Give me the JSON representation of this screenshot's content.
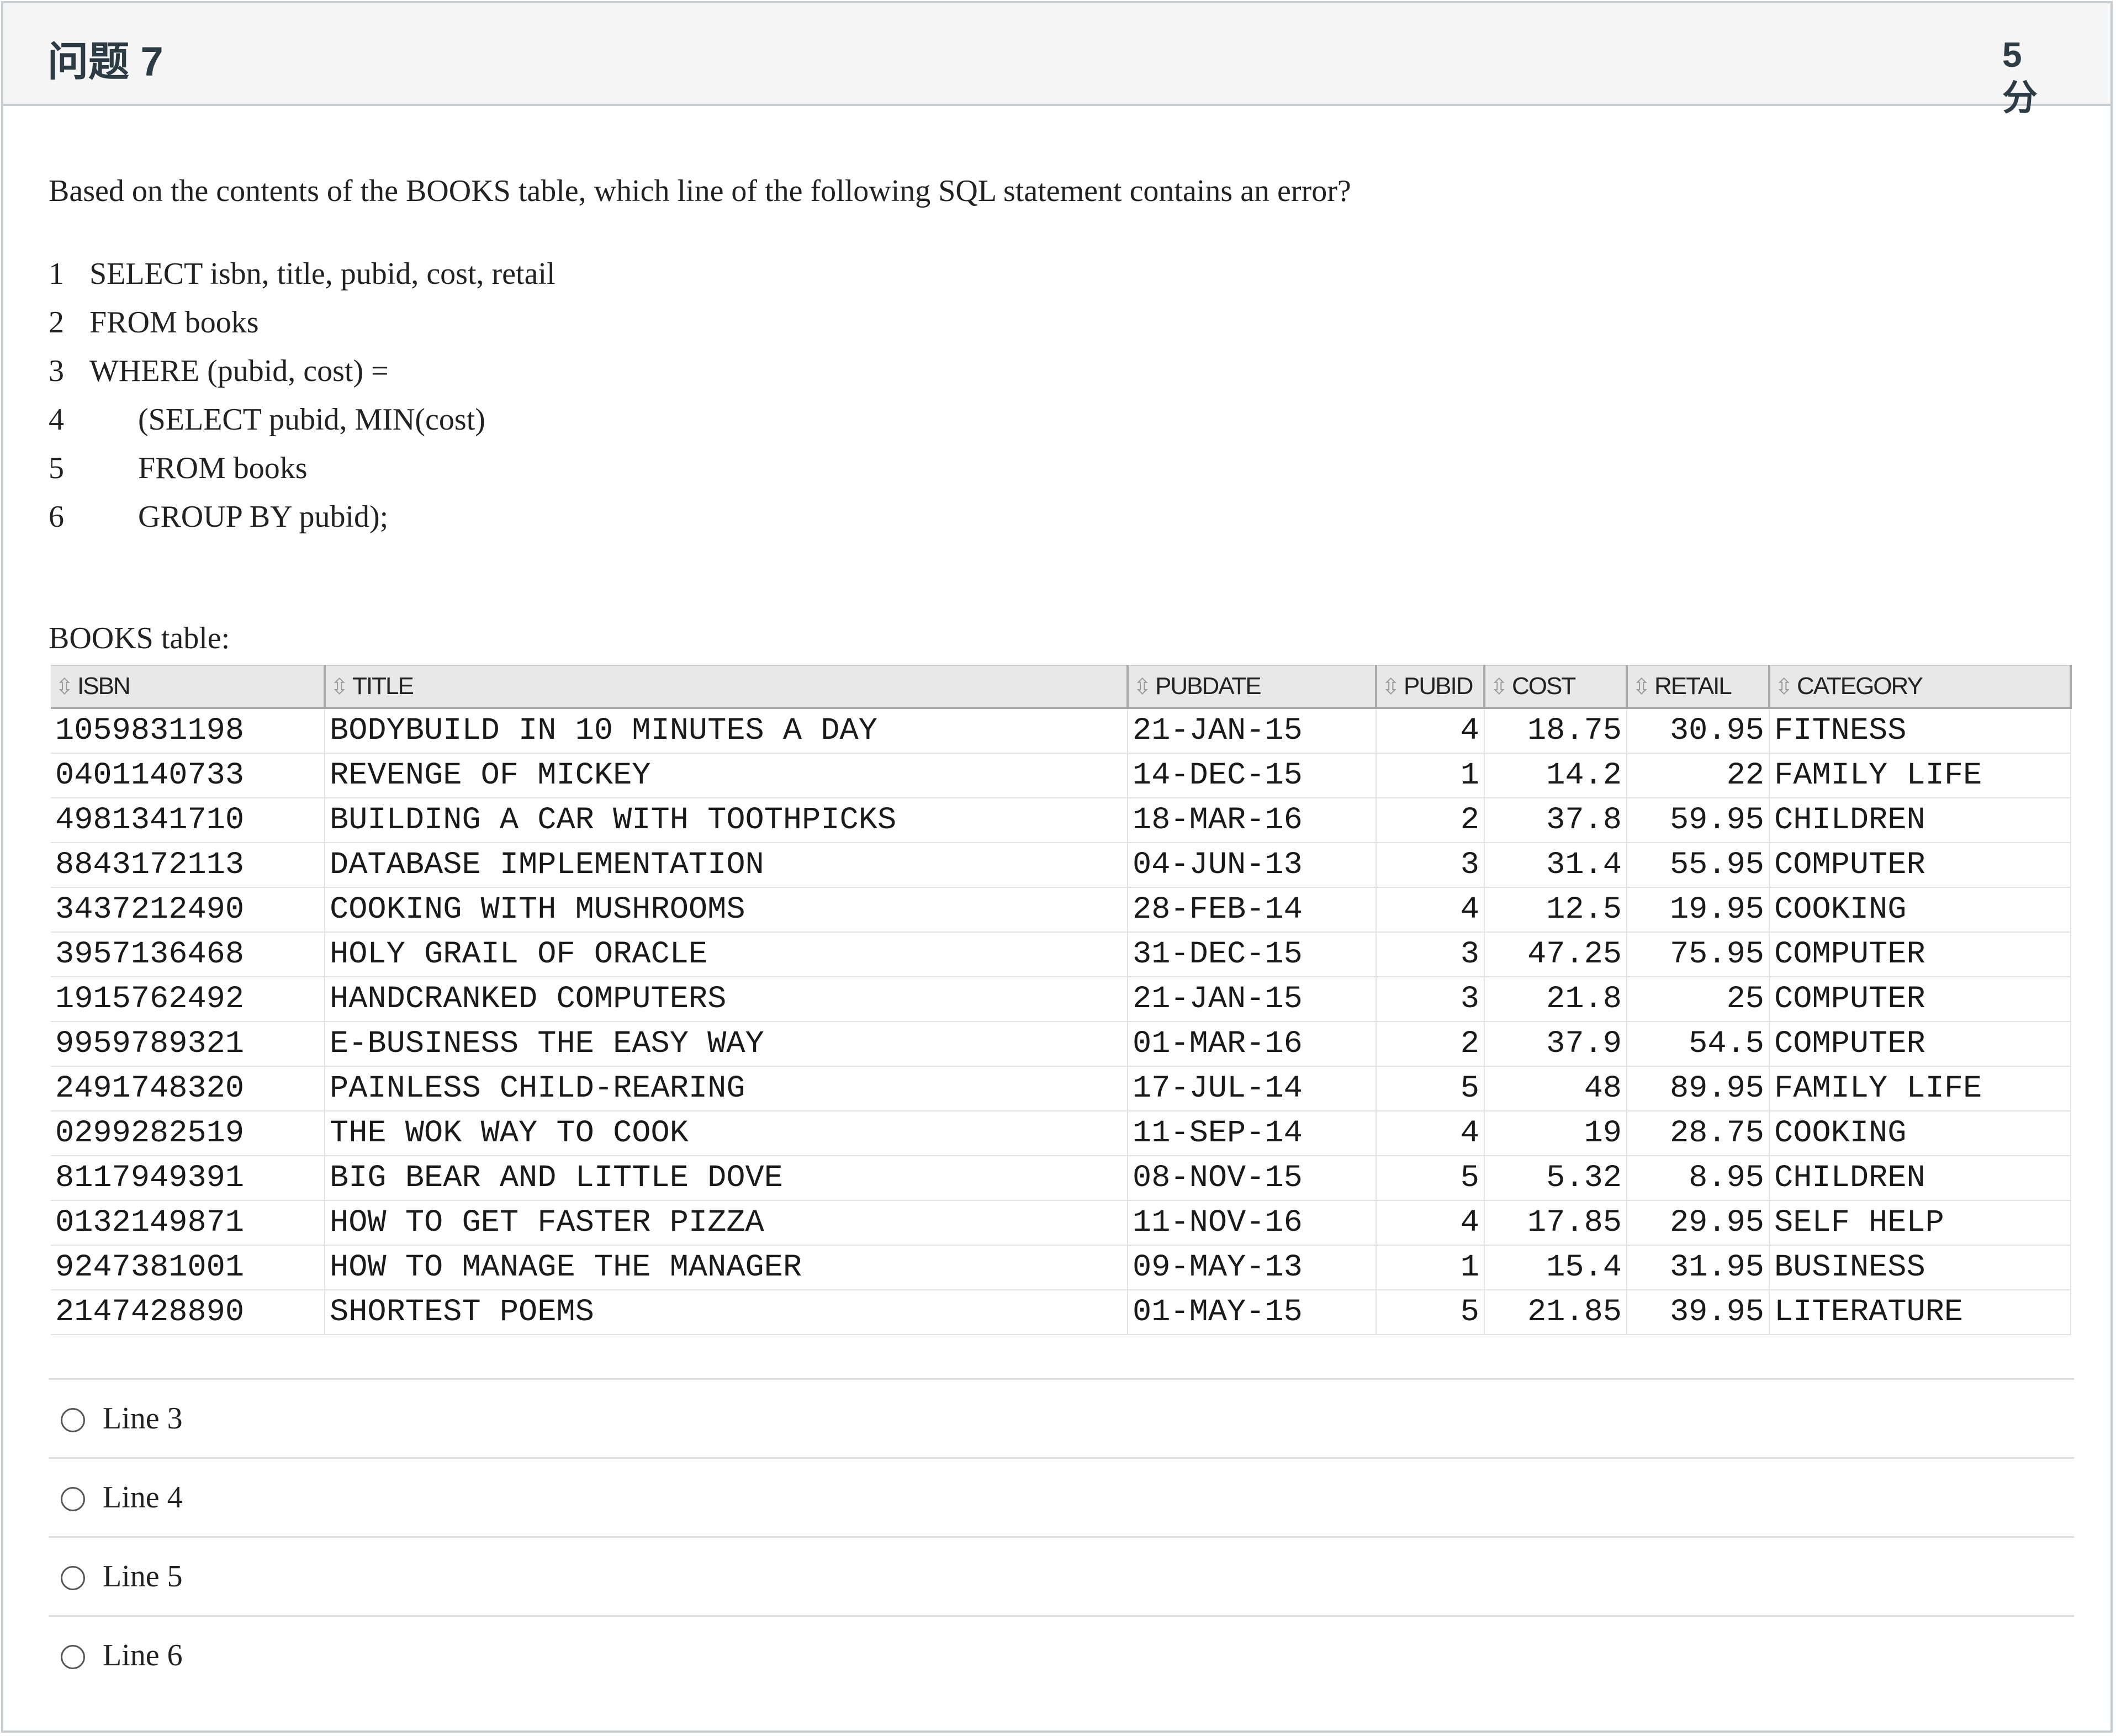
{
  "header": {
    "title": "问题 7",
    "points": "5 分"
  },
  "question": {
    "text": "Based on the contents of the BOOKS table, which line of the following SQL statement contains an error?",
    "sql_lines": [
      {
        "num": "1",
        "code": "SELECT isbn, title, pubid, cost, retail",
        "indent": false
      },
      {
        "num": "2",
        "code": "FROM books",
        "indent": false
      },
      {
        "num": "3",
        "code": "WHERE (pubid, cost) =",
        "indent": false
      },
      {
        "num": "4",
        "code": "(SELECT pubid, MIN(cost)",
        "indent": true
      },
      {
        "num": "5",
        "code": "FROM books",
        "indent": true
      },
      {
        "num": "6",
        "code": "GROUP BY pubid);",
        "indent": true
      }
    ],
    "table_caption": "BOOKS table:"
  },
  "books_table": {
    "columns": [
      "ISBN",
      "TITLE",
      "PUBDATE",
      "PUBID",
      "COST",
      "RETAIL",
      "CATEGORY"
    ],
    "rows": [
      [
        "1059831198",
        "BODYBUILD IN 10 MINUTES A DAY",
        "21-JAN-15",
        "4",
        "18.75",
        "30.95",
        "FITNESS"
      ],
      [
        "0401140733",
        "REVENGE OF MICKEY",
        "14-DEC-15",
        "1",
        "14.2",
        "22",
        "FAMILY LIFE"
      ],
      [
        "4981341710",
        "BUILDING A CAR WITH TOOTHPICKS",
        "18-MAR-16",
        "2",
        "37.8",
        "59.95",
        "CHILDREN"
      ],
      [
        "8843172113",
        "DATABASE IMPLEMENTATION",
        "04-JUN-13",
        "3",
        "31.4",
        "55.95",
        "COMPUTER"
      ],
      [
        "3437212490",
        "COOKING WITH MUSHROOMS",
        "28-FEB-14",
        "4",
        "12.5",
        "19.95",
        "COOKING"
      ],
      [
        "3957136468",
        "HOLY GRAIL OF ORACLE",
        "31-DEC-15",
        "3",
        "47.25",
        "75.95",
        "COMPUTER"
      ],
      [
        "1915762492",
        "HANDCRANKED COMPUTERS",
        "21-JAN-15",
        "3",
        "21.8",
        "25",
        "COMPUTER"
      ],
      [
        "9959789321",
        "E-BUSINESS THE EASY WAY",
        "01-MAR-16",
        "2",
        "37.9",
        "54.5",
        "COMPUTER"
      ],
      [
        "2491748320",
        "PAINLESS CHILD-REARING",
        "17-JUL-14",
        "5",
        "48",
        "89.95",
        "FAMILY LIFE"
      ],
      [
        "0299282519",
        "THE WOK WAY TO COOK",
        "11-SEP-14",
        "4",
        "19",
        "28.75",
        "COOKING"
      ],
      [
        "8117949391",
        "BIG BEAR AND LITTLE DOVE",
        "08-NOV-15",
        "5",
        "5.32",
        "8.95",
        "CHILDREN"
      ],
      [
        "0132149871",
        "HOW TO GET FASTER PIZZA",
        "11-NOV-16",
        "4",
        "17.85",
        "29.95",
        "SELF HELP"
      ],
      [
        "9247381001",
        "HOW TO MANAGE THE MANAGER",
        "09-MAY-13",
        "1",
        "15.4",
        "31.95",
        "BUSINESS"
      ],
      [
        "2147428890",
        "SHORTEST POEMS",
        "01-MAY-15",
        "5",
        "21.85",
        "39.95",
        "LITERATURE"
      ]
    ]
  },
  "answers": [
    {
      "label": "Line 3"
    },
    {
      "label": "Line 4"
    },
    {
      "label": "Line 5"
    },
    {
      "label": "Line 6"
    }
  ]
}
